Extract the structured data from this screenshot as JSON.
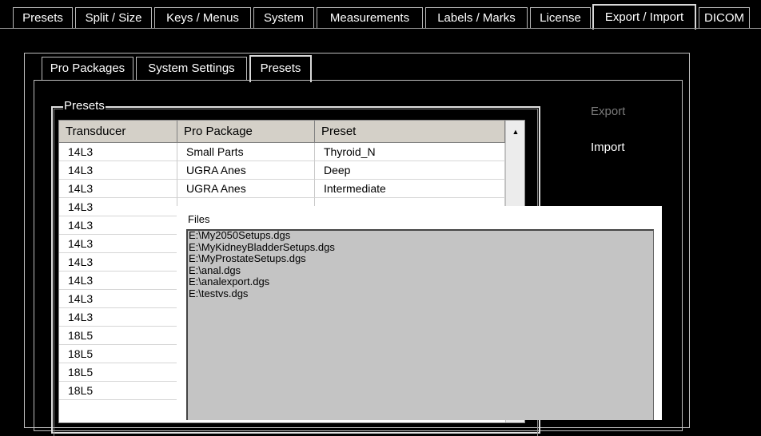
{
  "top_tabs": [
    "Presets",
    "Split / Size",
    "Keys / Menus",
    "System",
    "Measurements",
    "Labels / Marks",
    "License",
    "Export / Import",
    "DICOM"
  ],
  "sub_tabs": [
    "Pro Packages",
    "System Settings",
    "Presets"
  ],
  "presets": {
    "group_title": "Presets",
    "columns": [
      "Transducer",
      "Pro Package",
      "Preset"
    ],
    "rows": [
      [
        "14L3",
        "Small Parts",
        "Thyroid_N"
      ],
      [
        "14L3",
        "UGRA Anes",
        "Deep"
      ],
      [
        "14L3",
        "UGRA Anes",
        "Intermediate"
      ],
      [
        "14L3",
        "",
        ""
      ],
      [
        "14L3",
        "",
        ""
      ],
      [
        "14L3",
        "",
        ""
      ],
      [
        "14L3",
        "",
        ""
      ],
      [
        "14L3",
        "",
        ""
      ],
      [
        "14L3",
        "",
        ""
      ],
      [
        "14L3",
        "",
        ""
      ],
      [
        "18L5",
        "",
        ""
      ],
      [
        "18L5",
        "",
        ""
      ],
      [
        "18L5",
        "",
        ""
      ],
      [
        "18L5",
        "",
        ""
      ]
    ]
  },
  "actions": {
    "export": "Export",
    "import": "Import"
  },
  "files": {
    "label": "Files",
    "items": [
      "E:\\My2050Setups.dgs",
      "E:\\MyKidneyBladderSetups.dgs",
      "E:\\MyProstateSetups.dgs",
      "E:\\anal.dgs",
      "E:\\analexport.dgs",
      "E:\\testvs.dgs"
    ]
  },
  "colors": {
    "background": "#000000",
    "text": "#ffffff",
    "list_bg": "#c4c4c4",
    "header_bg": "#d4d0c8"
  }
}
